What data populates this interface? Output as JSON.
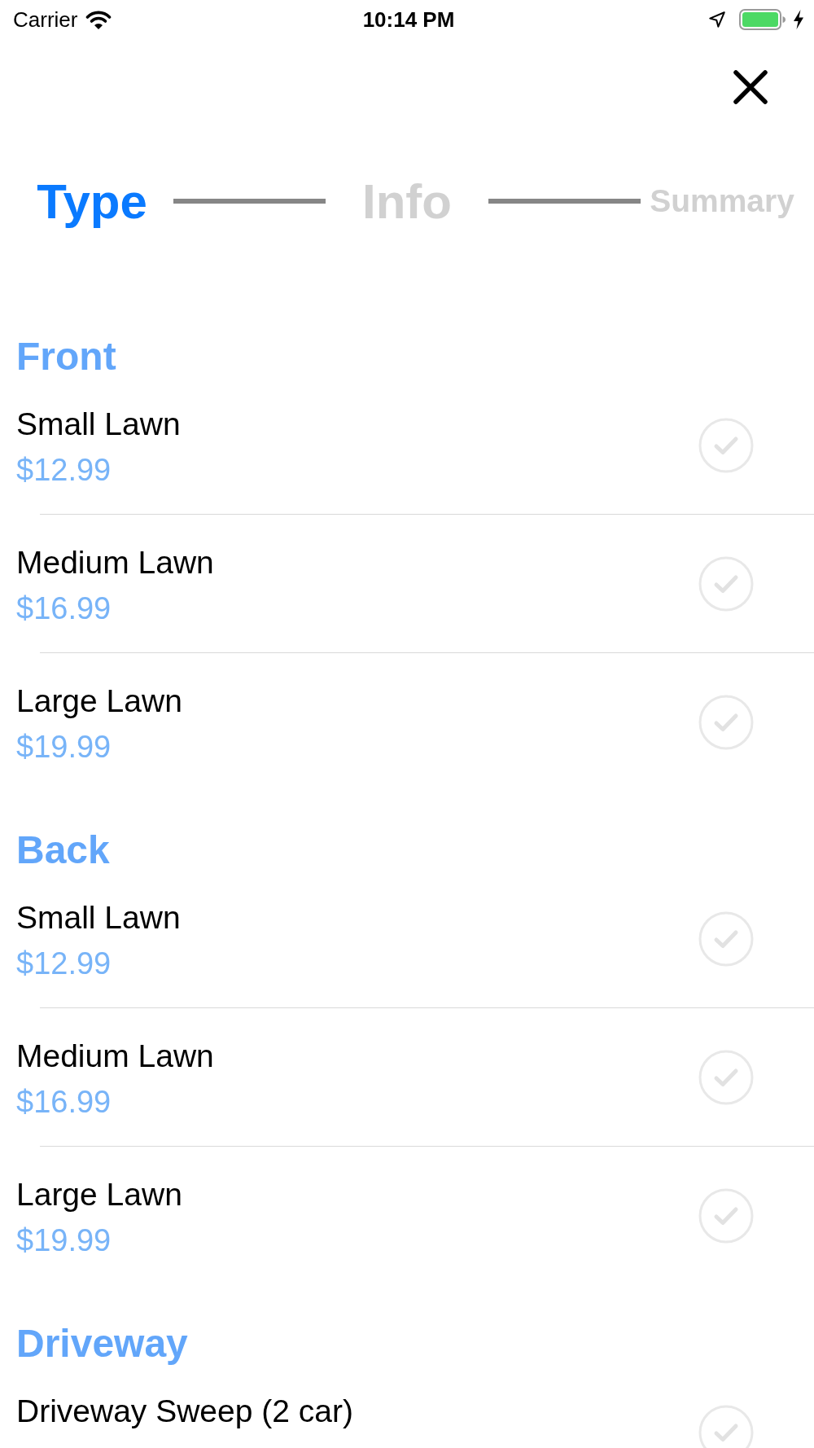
{
  "status_bar": {
    "carrier": "Carrier",
    "time": "10:14 PM"
  },
  "steps": [
    {
      "label": "Type",
      "selected": true
    },
    {
      "label": "Info",
      "selected": false
    },
    {
      "label": "Summary",
      "selected": false
    }
  ],
  "sections": [
    {
      "title": "Front",
      "items": [
        {
          "name": "Small Lawn",
          "price": "$12.99",
          "selected": false
        },
        {
          "name": "Medium Lawn",
          "price": "$16.99",
          "selected": false
        },
        {
          "name": "Large Lawn",
          "price": "$19.99",
          "selected": false
        }
      ]
    },
    {
      "title": "Back",
      "items": [
        {
          "name": "Small Lawn",
          "price": "$12.99",
          "selected": false
        },
        {
          "name": "Medium Lawn",
          "price": "$16.99",
          "selected": false
        },
        {
          "name": "Large Lawn",
          "price": "$19.99",
          "selected": false
        }
      ]
    },
    {
      "title": "Driveway",
      "items": [
        {
          "name": "Driveway Sweep (2 car)",
          "selected": false
        }
      ]
    }
  ]
}
